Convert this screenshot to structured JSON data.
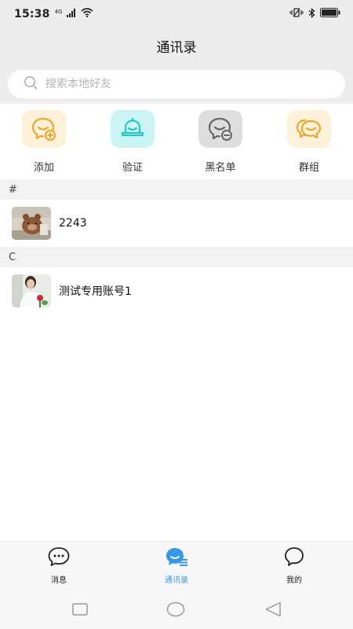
{
  "status_bar": {
    "time": "15:38",
    "network": "4G"
  },
  "header": {
    "title": "通讯录"
  },
  "search": {
    "placeholder": "搜索本地好友",
    "value": ""
  },
  "shortcuts": [
    {
      "label": "添加",
      "icon": "add-friend-icon",
      "color": "#f0a52a",
      "bg": "#fdf1d9"
    },
    {
      "label": "验证",
      "icon": "bell-icon",
      "color": "#2bc4c4",
      "bg": "#ccf6f6"
    },
    {
      "label": "黑名单",
      "icon": "blacklist-icon",
      "color": "#666666",
      "bg": "#dedede"
    },
    {
      "label": "群组",
      "icon": "group-icon",
      "color": "#f0a52a",
      "bg": "#fdf1d9"
    }
  ],
  "sections": [
    {
      "header": "#",
      "contacts": [
        {
          "name": "2243"
        }
      ]
    },
    {
      "header": "C",
      "contacts": [
        {
          "name": "测试专用账号1"
        }
      ]
    }
  ],
  "tabs": [
    {
      "label": "消息",
      "icon": "message-icon",
      "active": false
    },
    {
      "label": "通讯录",
      "icon": "contacts-icon",
      "active": true
    },
    {
      "label": "我的",
      "icon": "profile-icon",
      "active": false
    }
  ],
  "colors": {
    "accent": "#3a97e6",
    "header_bg": "#ededed"
  }
}
